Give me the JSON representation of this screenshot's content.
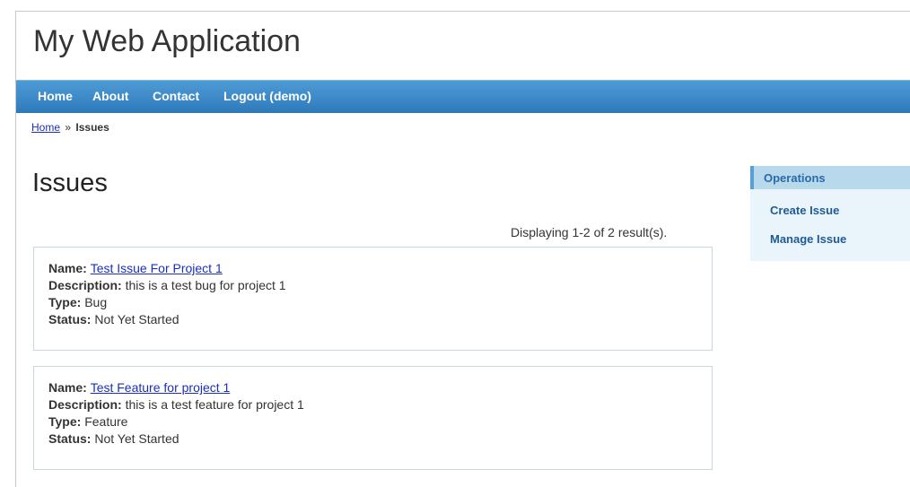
{
  "header": {
    "app_title": "My Web Application"
  },
  "menu": {
    "items": [
      {
        "label": "Home"
      },
      {
        "label": "About"
      },
      {
        "label": "Contact"
      },
      {
        "label": "Logout (demo)"
      }
    ]
  },
  "breadcrumb": {
    "home": "Home",
    "separator": "»",
    "current": "Issues"
  },
  "page": {
    "title": "Issues",
    "summary": "Displaying 1-2 of 2 result(s)."
  },
  "field_labels": {
    "name": "Name:",
    "description": "Description:",
    "type": "Type:",
    "status": "Status:"
  },
  "issues": [
    {
      "name": "Test Issue For Project 1",
      "description": "this is a test bug for project 1",
      "type": "Bug",
      "status": "Not Yet Started"
    },
    {
      "name": "Test Feature for project 1",
      "description": "this is a test feature for project 1",
      "type": "Feature",
      "status": "Not Yet Started"
    }
  ],
  "sidebar": {
    "title": "Operations",
    "links": [
      {
        "label": "Create Issue"
      },
      {
        "label": "Manage Issue"
      }
    ]
  },
  "colors": {
    "menu_bar": "#3f8bc9",
    "link": "#1a2fbf",
    "sidebar_bg": "#eaf5fb",
    "sidebar_header_bg": "#b8d8ec",
    "card_border": "#c8d6e3"
  }
}
